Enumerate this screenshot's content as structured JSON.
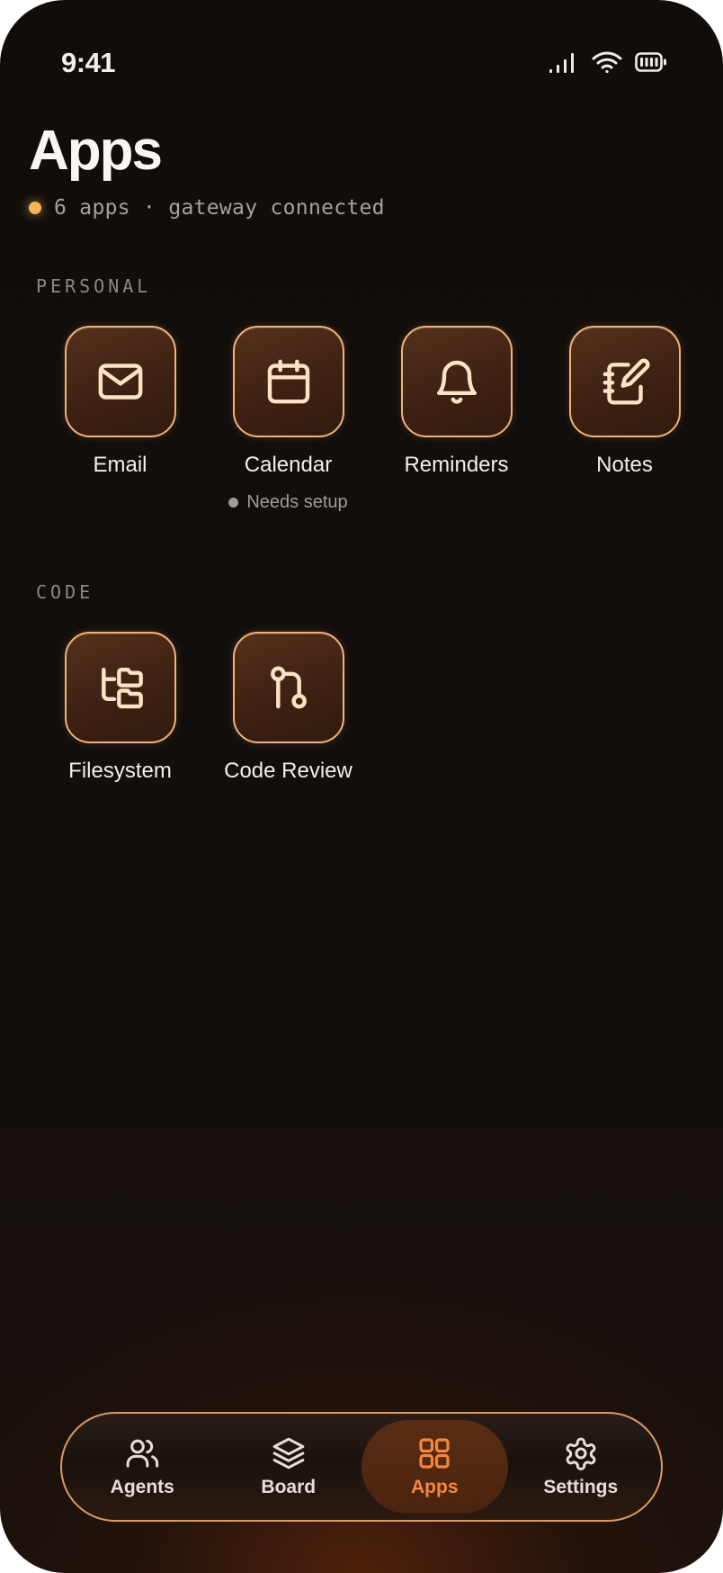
{
  "status_bar": {
    "time": "9:41",
    "icons": [
      "signal-icon",
      "wifi-icon",
      "battery-icon"
    ]
  },
  "header": {
    "title": "Apps",
    "status_text": "6 apps · gateway connected",
    "status_color": "#f7b45d"
  },
  "sections": [
    {
      "label": "PERSONAL",
      "apps": [
        {
          "name": "Email",
          "icon": "mail-icon"
        },
        {
          "name": "Calendar",
          "icon": "calendar-icon",
          "note": "Needs setup"
        },
        {
          "name": "Reminders",
          "icon": "bell-icon"
        },
        {
          "name": "Notes",
          "icon": "notebook-pen-icon"
        }
      ]
    },
    {
      "label": "CODE",
      "apps": [
        {
          "name": "Filesystem",
          "icon": "folder-tree-icon"
        },
        {
          "name": "Code Review",
          "icon": "git-pull-request-icon"
        }
      ]
    }
  ],
  "tab_bar": {
    "tabs": [
      {
        "label": "Agents",
        "icon": "users-icon",
        "active": false
      },
      {
        "label": "Board",
        "icon": "layers-icon",
        "active": false
      },
      {
        "label": "Apps",
        "icon": "grid-icon",
        "active": true
      },
      {
        "label": "Settings",
        "icon": "gear-icon",
        "active": false
      }
    ]
  },
  "colors": {
    "accent": "#f7873a",
    "tile_border": "#f0b27a",
    "icon_stroke": "#fbe3c6",
    "background": "#110d0b"
  }
}
